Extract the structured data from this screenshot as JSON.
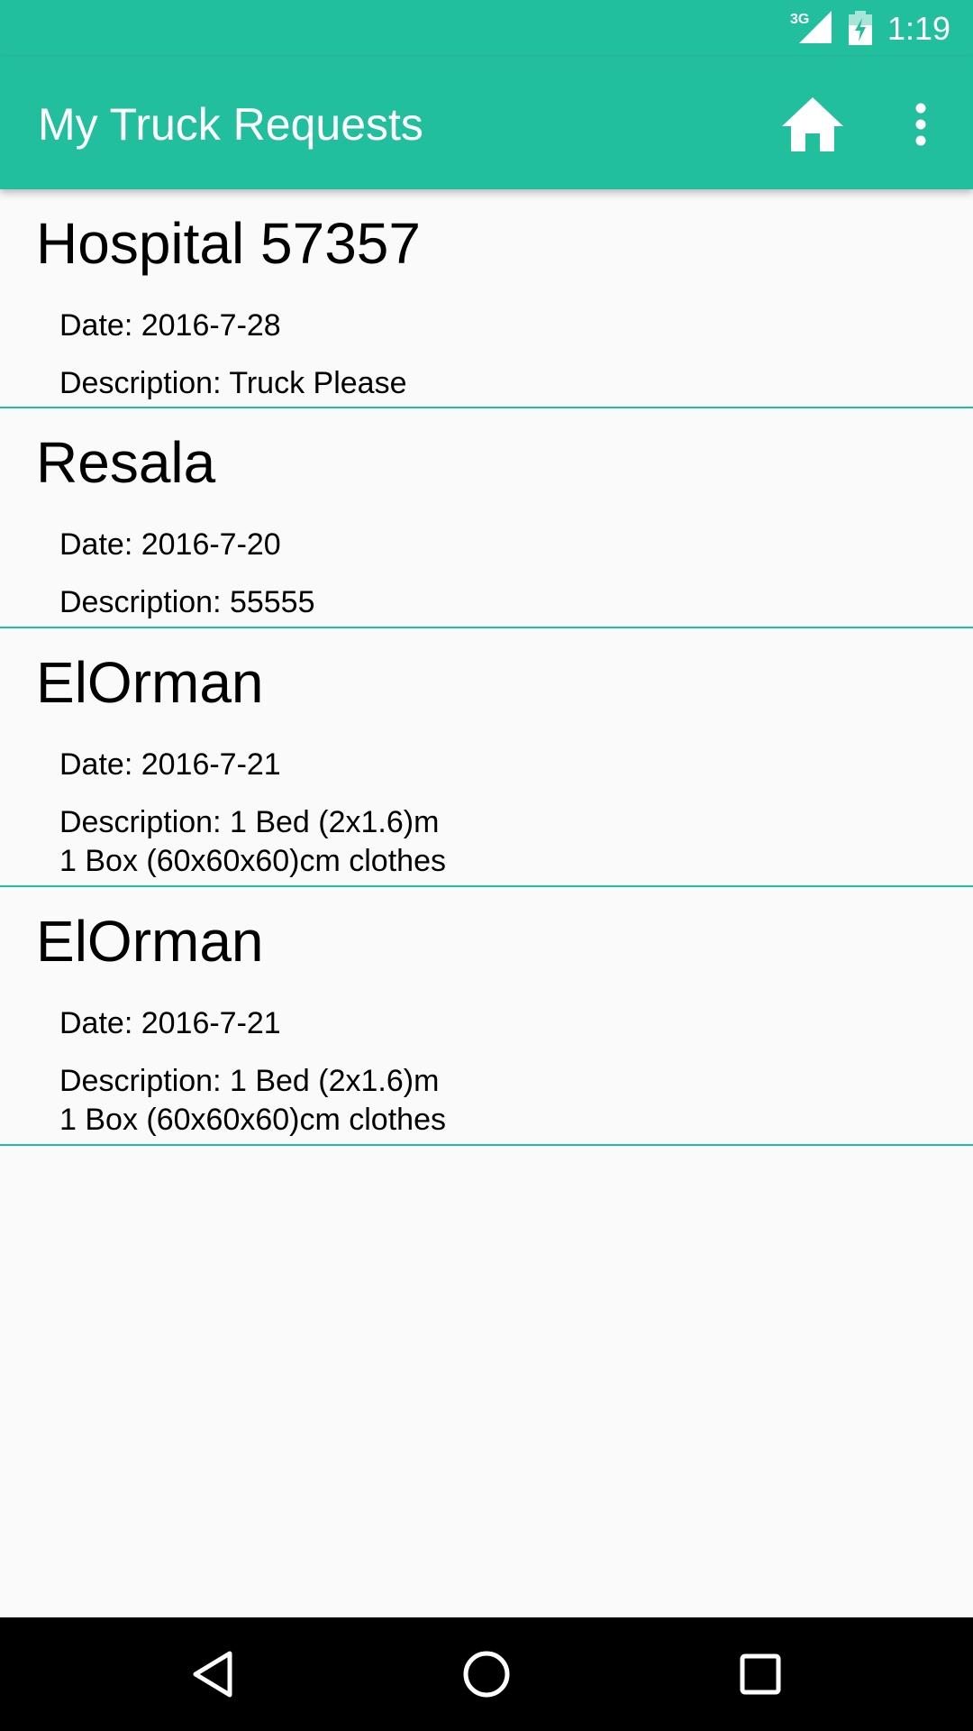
{
  "status_bar": {
    "network_label": "3G",
    "time": "1:19",
    "icons": [
      "signal-3g-icon",
      "battery-charging-icon"
    ]
  },
  "app_bar": {
    "title": "My Truck Requests",
    "actions": [
      "home-icon",
      "overflow-menu-icon"
    ]
  },
  "colors": {
    "primary": "#22bf9e",
    "divider": "#22bf9e",
    "background": "#fafafa",
    "nav_bar": "#000000"
  },
  "requests": [
    {
      "name": "Hospital 57357",
      "date": "Date: 2016-7-28",
      "description": "Description: Truck Please"
    },
    {
      "name": "Resala",
      "date": "Date: 2016-7-20",
      "description": "Description: 55555"
    },
    {
      "name": "ElOrman",
      "date": "Date: 2016-7-21",
      "description": "Description: 1 Bed (2x1.6)m\n1 Box (60x60x60)cm clothes"
    },
    {
      "name": "ElOrman",
      "date": "Date: 2016-7-21",
      "description": "Description: 1 Bed (2x1.6)m\n1 Box (60x60x60)cm clothes"
    }
  ],
  "nav_bar": {
    "buttons": [
      "back-icon",
      "home-circle-icon",
      "recents-icon"
    ]
  }
}
